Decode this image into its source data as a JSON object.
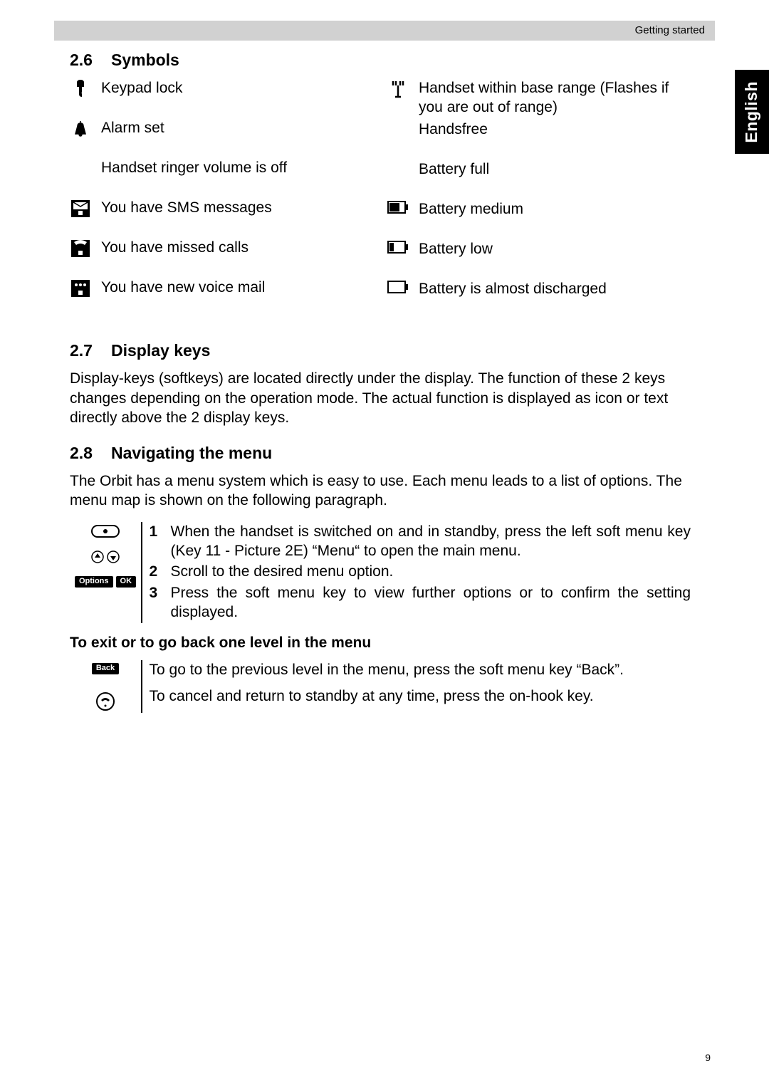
{
  "header": {
    "section": "Getting started"
  },
  "sideTab": "English",
  "sec26": {
    "num": "2.6",
    "title": "Symbols"
  },
  "symbols": {
    "left": [
      "Keypad lock",
      "Alarm set",
      "Handset ringer volume is off",
      "You have SMS messages",
      "You have missed calls",
      "You have new voice mail"
    ],
    "right": [
      "Handset within base range (Flashes if you are out of range)",
      "Handsfree",
      "Battery full",
      "Battery medium",
      "Battery low",
      "Battery is almost discharged"
    ]
  },
  "sec27": {
    "num": "2.7",
    "title": "Display keys",
    "body": "Display-keys (softkeys) are located directly under the display. The function of these 2 keys changes depending on the operation mode. The actual function is displayed as icon or text directly above the 2 display keys."
  },
  "sec28": {
    "num": "2.8",
    "title": "Navigating the menu",
    "intro": "The Orbit has a menu system which is easy to use. Each menu leads to a list of options. The menu map is shown on the following paragraph.",
    "steps": [
      "When the handset is switched on and in standby, press the left soft menu key (Key 11 - Picture 2E) “Menu“ to open the main menu.",
      "Scroll to the desired menu option.",
      "Press the soft menu key to view further options or to confirm the setting displayed."
    ],
    "keys": {
      "options": "Options",
      "ok": "OK"
    },
    "exitTitle": "To exit or to go back one level in the menu",
    "exit": {
      "backKey": "Back",
      "backText": "To go to the previous level in the menu, press the soft menu key “Back”.",
      "cancelText": "To cancel and return to standby at any time, press the on-hook key."
    }
  },
  "pageNumber": "9"
}
